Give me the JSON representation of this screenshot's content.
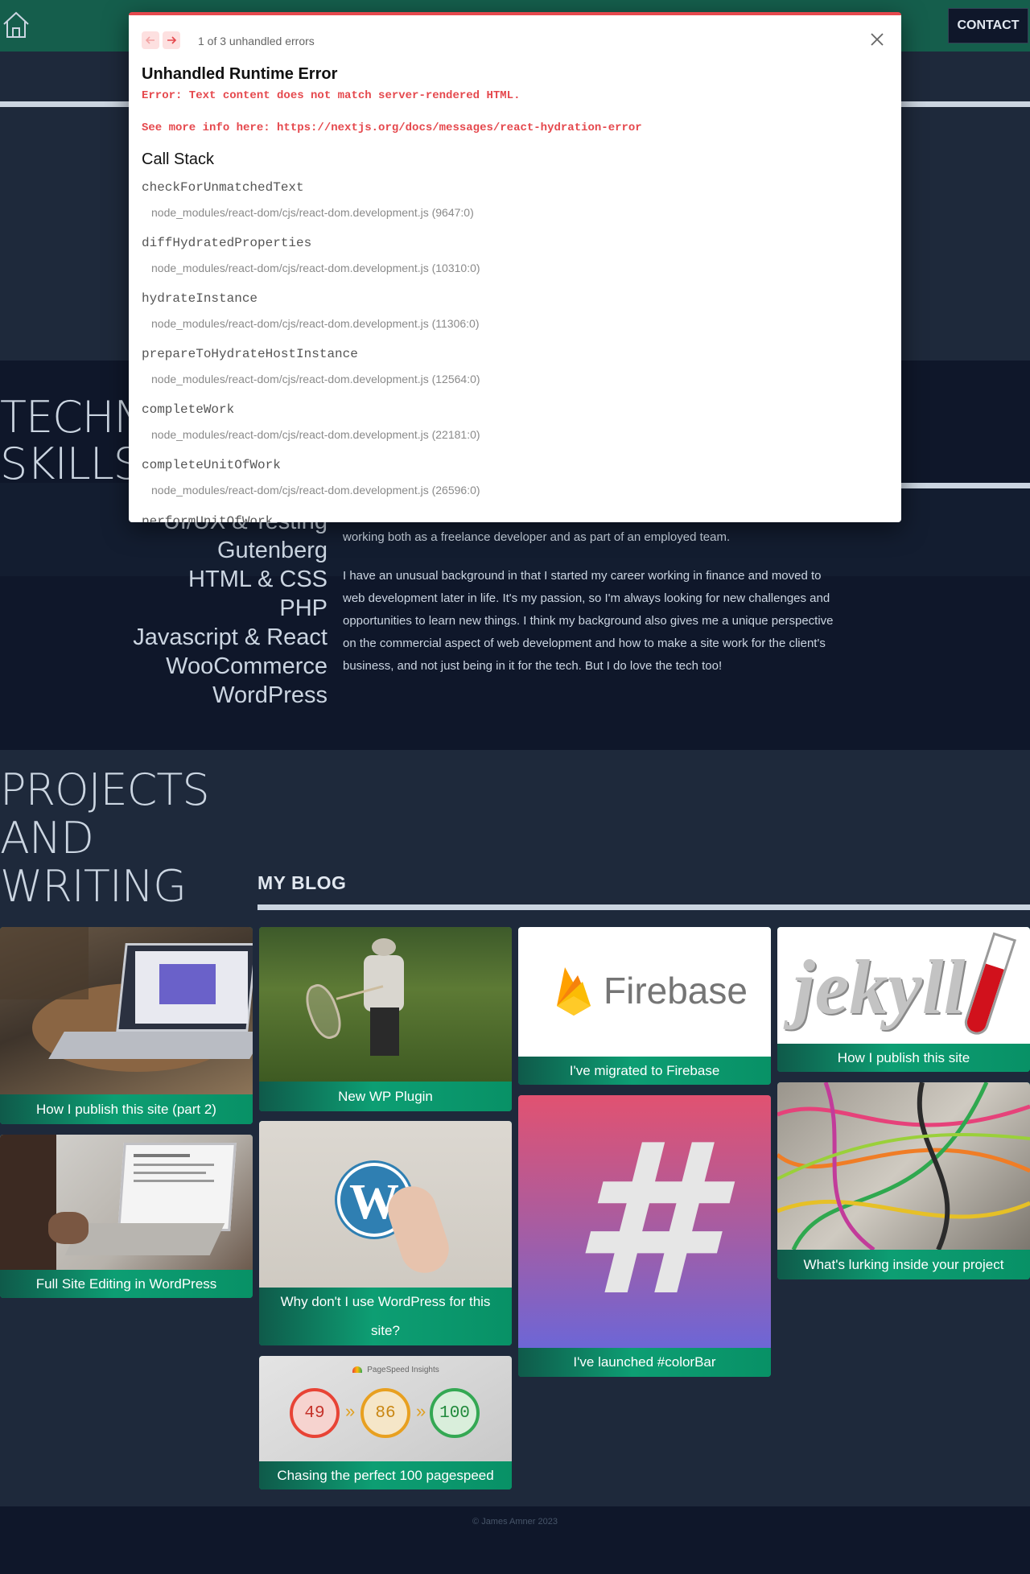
{
  "nav": {
    "contact_label": "CONTACT"
  },
  "skills": {
    "title_line1": "TECHNICAL",
    "title_line2": "SKILLS",
    "items": [
      "UI/UX & Testing",
      "Gutenberg",
      "HTML & CSS",
      "PHP",
      "Javascript & React",
      "WooCommerce",
      "WordPress"
    ]
  },
  "about": {
    "p1": "working both as a freelance developer and as part of an employed team.",
    "p2": "I have an unusual background in that I started my career working in finance and moved to web development later in life. It's my passion, so I'm always looking for new challenges and opportunities to learn new things. I think my background also gives me a unique perspective on the commercial aspect of web development and how to make a site work for the client's business, and not just being in it for the tech. But I do love the tech too!"
  },
  "projects": {
    "title_line1": "PROJECTS",
    "title_line2": "AND",
    "title_line3": "WRITING"
  },
  "blog": {
    "heading": "MY BLOG",
    "cards": [
      {
        "title": "How I publish this site (part 2)"
      },
      {
        "title": "Full Site Editing in WordPress"
      },
      {
        "title": "New WP Plugin"
      },
      {
        "title": "Why don't I use WordPress for this site?"
      },
      {
        "title": "Chasing the perfect 100 pagespeed"
      },
      {
        "title": "I've migrated to Firebase"
      },
      {
        "title": "I've launched #colorBar"
      },
      {
        "title": "How I publish this site"
      },
      {
        "title": "What's lurking inside your project"
      }
    ]
  },
  "images": {
    "firebase_word": "Firebase",
    "jekyll_word": "jekyll",
    "hash_symbol": "#",
    "pagespeed_label": "PageSpeed Insights",
    "pagespeed_scores": [
      "49",
      "86",
      "100"
    ],
    "pagespeed_arrow": "»"
  },
  "footer": {
    "text": "© James Amner 2023"
  },
  "error": {
    "count_text": "1 of 3 unhandled errors",
    "title": "Unhandled Runtime Error",
    "message": "Error: Text content does not match server-rendered HTML.",
    "link": "See more info here: https://nextjs.org/docs/messages/react-hydration-error",
    "callstack_title": "Call Stack",
    "frames": [
      {
        "fn": "checkForUnmatchedText",
        "loc": "node_modules/react-dom/cjs/react-dom.development.js (9647:0)"
      },
      {
        "fn": "diffHydratedProperties",
        "loc": "node_modules/react-dom/cjs/react-dom.development.js (10310:0)"
      },
      {
        "fn": "hydrateInstance",
        "loc": "node_modules/react-dom/cjs/react-dom.development.js (11306:0)"
      },
      {
        "fn": "prepareToHydrateHostInstance",
        "loc": "node_modules/react-dom/cjs/react-dom.development.js (12564:0)"
      },
      {
        "fn": "completeWork",
        "loc": "node_modules/react-dom/cjs/react-dom.development.js (22181:0)"
      },
      {
        "fn": "completeUnitOfWork",
        "loc": "node_modules/react-dom/cjs/react-dom.development.js (26596:0)"
      },
      {
        "fn": "performUnitOfWork",
        "loc": ""
      }
    ]
  },
  "colors": {
    "accent": "#0d9e73",
    "nav": "#155e4c",
    "error": "#e5484d",
    "bg_dark": "#0f172a",
    "bg": "#1e293b"
  }
}
